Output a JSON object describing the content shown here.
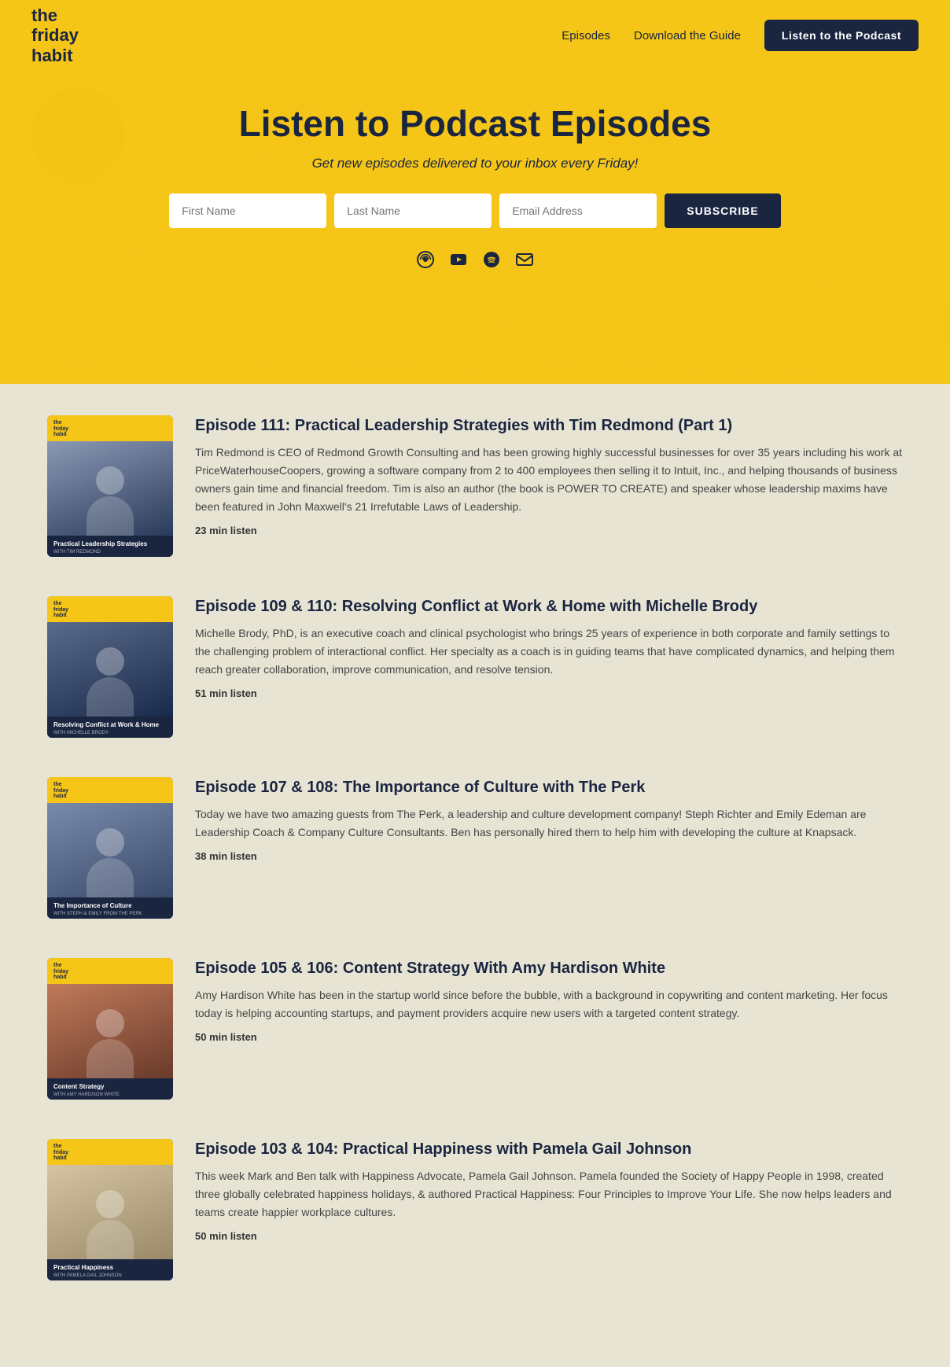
{
  "header": {
    "logo": [
      "the",
      "friday",
      "habit"
    ],
    "nav": {
      "episodes_label": "Episodes",
      "guide_label": "Download the Guide",
      "podcast_btn_label": "Listen to the Podcast"
    }
  },
  "hero": {
    "title": "Listen to Podcast Episodes",
    "subtitle": "Get new episodes delivered to your inbox every Friday!",
    "form": {
      "first_name_placeholder": "First Name",
      "last_name_placeholder": "Last Name",
      "email_placeholder": "Email Address",
      "subscribe_btn": "SUBSCRIBE"
    },
    "social_icons": [
      "podcast-icon",
      "youtube-icon",
      "spotify-icon",
      "email-icon"
    ]
  },
  "episodes": [
    {
      "number": "Episode 111",
      "title": "Episode 111: Practical Leadership Strategies with Tim Redmond (Part 1)",
      "thumb_title": "Practical Leadership Strategies",
      "thumb_sub": "WITH TIM REDMOND",
      "duration": "23 min listen",
      "desc": "Tim Redmond is CEO of Redmond Growth Consulting and has been growing highly successful businesses for over 35 years including his work at PriceWaterhouseCoopers, growing a software company from 2 to 400 employees then selling it to Intuit, Inc., and helping thousands of business owners gain time and financial freedom. Tim is also an author (the book is POWER TO CREATE) and speaker whose leadership maxims have been featured in John Maxwell's 21 Irrefutable Laws of Leadership."
    },
    {
      "number": "Episode 109 & 110",
      "title": "Episode 109 & 110: Resolving Conflict at Work & Home with Michelle Brody",
      "thumb_title": "Resolving Conflict at Work & Home",
      "thumb_sub": "WITH MICHELLE BRODY",
      "duration": "51 min listen",
      "desc": "Michelle Brody, PhD, is an executive coach and clinical psychologist who brings 25 years of experience in both corporate and family settings to the challenging problem of interactional conflict. Her specialty as a coach is in guiding teams that have complicated dynamics, and helping them reach greater collaboration, improve communication, and resolve tension."
    },
    {
      "number": "Episode 107 & 108",
      "title": "Episode 107 & 108: The Importance of Culture with The Perk",
      "thumb_title": "The Importance of Culture",
      "thumb_sub": "WITH STEPH & EMILY FROM THE PERK",
      "duration": "38 min listen",
      "desc": "Today we have two amazing guests from The Perk, a leadership and culture development company! Steph Richter and Emily Edeman are Leadership Coach & Company Culture Consultants. Ben has personally hired them to help him with developing the culture at Knapsack."
    },
    {
      "number": "Episode 105 & 106",
      "title": "Episode 105 & 106: Content Strategy With Amy Hardison White",
      "thumb_title": "Content Strategy",
      "thumb_sub": "WITH AMY HARDISON WHITE",
      "duration": "50 min listen",
      "desc": "Amy Hardison White has been in the startup world since before the bubble, with a background in copywriting and content marketing. Her focus today is helping accounting startups, and payment providers acquire new users with a targeted content strategy."
    },
    {
      "number": "Episode 103 & 104",
      "title": "Episode 103 & 104: Practical Happiness with Pamela Gail Johnson",
      "thumb_title": "Practical Happiness",
      "thumb_sub": "WITH PAMELA GAIL JOHNSON",
      "duration": "50 min listen",
      "desc": "This week Mark and Ben talk with Happiness Advocate, Pamela Gail Johnson. Pamela founded the Society of Happy People in 1998, created three globally celebrated happiness holidays, & authored Practical Happiness: Four Principles to Improve Your Life. She now helps leaders and teams create happier workplace cultures."
    }
  ],
  "colors": {
    "yellow": "#f5c518",
    "dark_navy": "#1a2540",
    "bg_cream": "#e8e4d4"
  }
}
